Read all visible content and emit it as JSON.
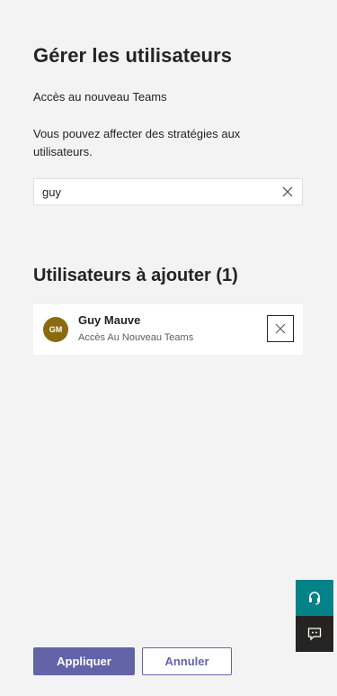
{
  "page": {
    "title": "Gérer les utilisateurs",
    "policy_name": "Accès au nouveau Teams",
    "description": "Vous pouvez affecter des stratégies aux utilisateurs."
  },
  "search": {
    "value": "guy",
    "clear_icon": "close-icon"
  },
  "users_section": {
    "title": "Utilisateurs à ajouter (1)",
    "users": [
      {
        "initials": "GM",
        "name": "Guy Mauve",
        "policy": "Accès Au Nouveau Teams",
        "avatar_color": "#8a6b0f",
        "remove_icon": "close-icon"
      }
    ]
  },
  "floating": {
    "help_icon": "headset-icon",
    "help_color": "#038387",
    "feedback_icon": "feedback-icon",
    "feedback_color": "#252423"
  },
  "footer": {
    "apply_label": "Appliquer",
    "cancel_label": "Annuler",
    "accent_color": "#6264a7"
  }
}
